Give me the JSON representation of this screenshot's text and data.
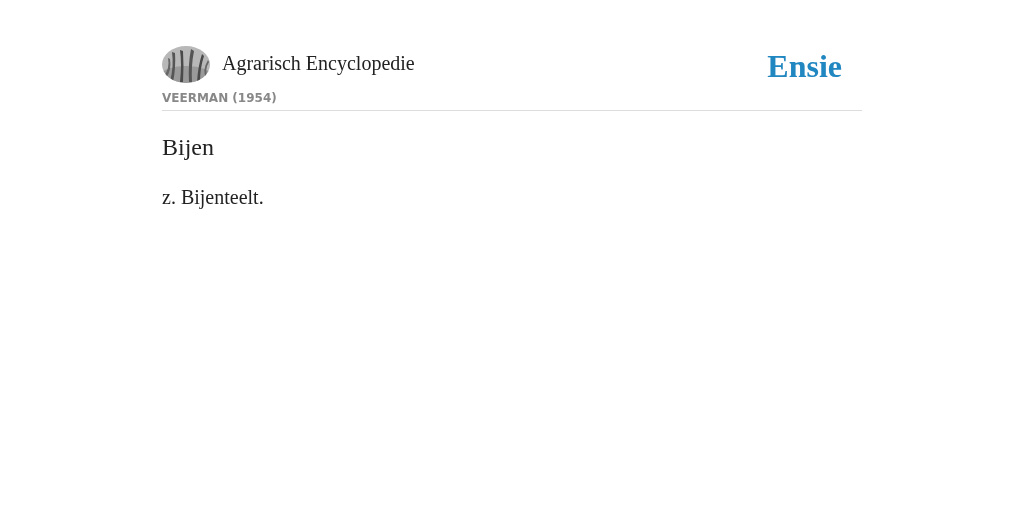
{
  "header": {
    "source_title": "Agrarisch Encyclopedie",
    "source_author": "VEERMAN (1954)",
    "logo": "Ensie"
  },
  "article": {
    "title": "Bijen",
    "body": "z. Bijenteelt."
  }
}
